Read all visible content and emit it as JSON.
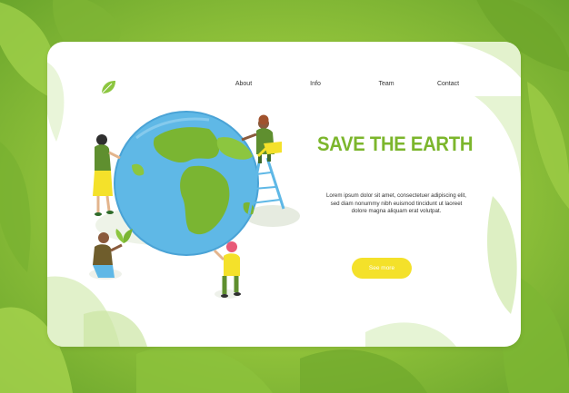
{
  "nav": {
    "items": [
      {
        "label": "About"
      },
      {
        "label": "Info"
      },
      {
        "label": "Team"
      },
      {
        "label": "Contact"
      }
    ]
  },
  "hero": {
    "title": "SAVE THE EARTH",
    "description": "Lorem ipsum dolor sit amet, consectetuer adipiscing elit, sed diam nonummy nibh euismod tincidunt ut laoreet dolore magna aliquam erat volutpat.",
    "button_label": "See more"
  },
  "icons": {
    "logo": "leaf-icon"
  },
  "colors": {
    "accent_green": "#7cb62c",
    "button_yellow": "#f4e12a",
    "background_green": "#8fc13a",
    "ocean_blue": "#58b6e4",
    "land_green": "#7ab532"
  }
}
